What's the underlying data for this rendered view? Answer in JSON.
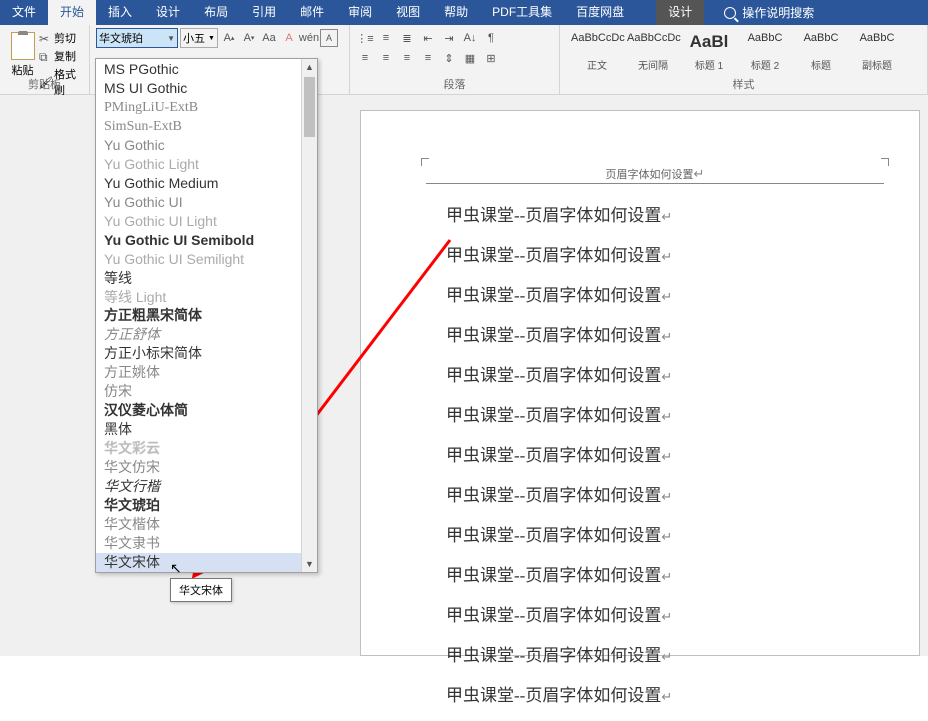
{
  "menubar": {
    "tabs": [
      "文件",
      "开始",
      "插入",
      "设计",
      "布局",
      "引用",
      "邮件",
      "审阅",
      "视图",
      "帮助",
      "PDF工具集",
      "百度网盘"
    ],
    "context_tab": "设计",
    "search_placeholder": "操作说明搜索"
  },
  "ribbon": {
    "clipboard": {
      "label": "剪贴板",
      "paste": "粘贴",
      "cut": "剪切",
      "copy": "复制",
      "format_painter": "格式刷"
    },
    "font": {
      "selected_font": "华文琥珀",
      "size": "小五"
    },
    "paragraph": {
      "label": "段落"
    },
    "styles": {
      "label": "样式",
      "items": [
        {
          "preview": "AaBbCcDc",
          "name": "正文"
        },
        {
          "preview": "AaBbCcDc",
          "name": "无间隔"
        },
        {
          "preview": "AaBl",
          "name": "标题 1"
        },
        {
          "preview": "AaBbC",
          "name": "标题 2"
        },
        {
          "preview": "AaBbC",
          "name": "标题"
        },
        {
          "preview": "AaBbC",
          "name": "副标题"
        }
      ]
    }
  },
  "font_dropdown": {
    "items": [
      {
        "t": "MS PGothic",
        "s": ""
      },
      {
        "t": "MS UI Gothic",
        "s": ""
      },
      {
        "t": "PMingLiU-ExtB",
        "s": "font-family:PMingLiU,serif;color:#888"
      },
      {
        "t": "SimSun-ExtB",
        "s": "font-family:SimSun,serif;color:#888"
      },
      {
        "t": "Yu Gothic",
        "s": "color:#888"
      },
      {
        "t": "Yu Gothic Light",
        "s": "color:#aaa;font-weight:300"
      },
      {
        "t": "Yu Gothic Medium",
        "s": ""
      },
      {
        "t": "Yu Gothic UI",
        "s": "color:#888"
      },
      {
        "t": "Yu Gothic UI Light",
        "s": "color:#aaa;font-weight:300"
      },
      {
        "t": "Yu Gothic UI Semibold",
        "s": "font-weight:600"
      },
      {
        "t": "Yu Gothic UI Semilight",
        "s": "color:#aaa"
      },
      {
        "t": "等线",
        "s": "font-family:DengXian,sans-serif"
      },
      {
        "t": "等线 Light",
        "s": "font-family:DengXian,sans-serif;color:#aaa;font-weight:300"
      },
      {
        "t": "方正粗黑宋简体",
        "s": "font-family:SimHei;font-weight:bold"
      },
      {
        "t": "方正舒体",
        "s": "font-family:STKaiti,KaiTi;color:#888;font-style:italic"
      },
      {
        "t": "方正小标宋简体",
        "s": "font-family:SimSun,serif"
      },
      {
        "t": "方正姚体",
        "s": "font-family:FZYaoti,SimSun;color:#888"
      },
      {
        "t": "仿宋",
        "s": "font-family:FangSong,serif;color:#888"
      },
      {
        "t": "汉仪菱心体简",
        "s": "font-family:SimHei;font-weight:bold"
      },
      {
        "t": "黑体",
        "s": "font-family:SimHei"
      },
      {
        "t": "华文彩云",
        "s": "font-family:STCaiyun;color:#bbb;text-shadow:0 0 1px #888"
      },
      {
        "t": "华文仿宋",
        "s": "font-family:STFangsong,FangSong;color:#888"
      },
      {
        "t": "华文行楷",
        "s": "font-family:STXingkai,KaiTi;font-style:italic"
      },
      {
        "t": "华文琥珀",
        "s": "font-family:STHupo,SimHei;font-weight:900"
      },
      {
        "t": "华文楷体",
        "s": "font-family:STKaiti,KaiTi;color:#888"
      },
      {
        "t": "华文隶书",
        "s": "font-family:STLiti,LiSu;color:#888"
      },
      {
        "t": "华文宋体",
        "s": "font-family:STSong,SimSun"
      }
    ],
    "hovered_index": 26,
    "tooltip": "华文宋体"
  },
  "document": {
    "header_text": "页眉字体如何设置",
    "body_line": "甲虫课堂--页眉字体如何设置",
    "line_count": 13
  }
}
